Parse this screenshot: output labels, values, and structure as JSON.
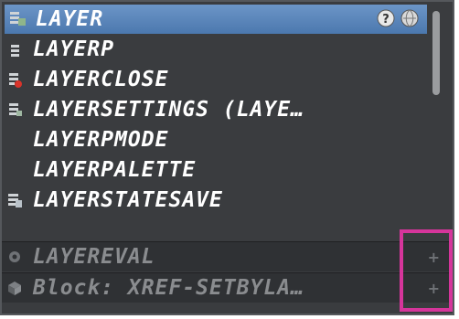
{
  "autocomplete": {
    "items": [
      {
        "label": "LAYER",
        "icon": "layer-properties-icon",
        "selected": true
      },
      {
        "label": "LAYERP",
        "icon": "layer-previous-icon"
      },
      {
        "label": "LAYERCLOSE",
        "icon": "layer-close-icon"
      },
      {
        "label": "LAYERSETTINGS (LAYE…",
        "icon": "layer-settings-icon"
      },
      {
        "label": "LAYERPMODE",
        "icon": ""
      },
      {
        "label": "LAYERPALETTE",
        "icon": ""
      },
      {
        "label": "LAYERSTATESAVE",
        "icon": "layer-state-save-icon"
      }
    ],
    "sections": [
      {
        "label": "LAYEREVAL",
        "icon": "system-variable-gear-icon"
      },
      {
        "label": "Block: XREF-SETBYLA…",
        "icon": "block-icon"
      }
    ]
  },
  "colors": {
    "selected_row": "#5b86bb",
    "panel_bg": "#3a3c3f",
    "highlight_box": "#d6359b"
  }
}
